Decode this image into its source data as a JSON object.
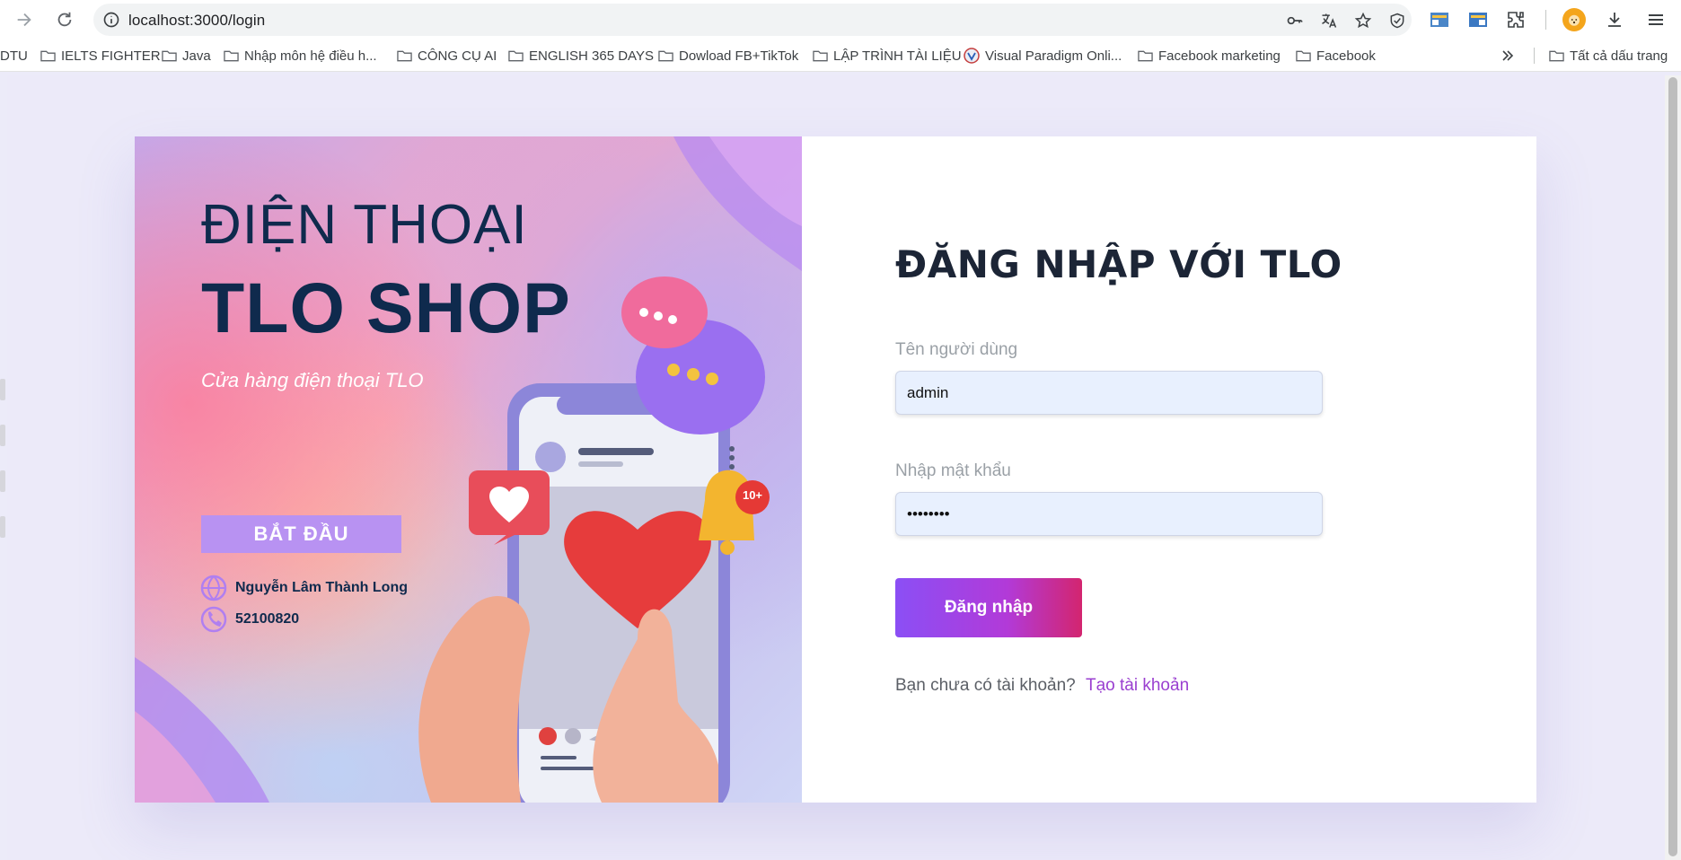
{
  "browser": {
    "url": "localhost:3000/login",
    "bookmarks": [
      {
        "label": "DTU",
        "folder": false
      },
      {
        "label": "IELTS FIGHTER",
        "folder": true
      },
      {
        "label": "Java",
        "folder": true
      },
      {
        "label": "Nhập môn hệ điều h...",
        "folder": true
      },
      {
        "label": "CÔNG CỤ AI",
        "folder": true
      },
      {
        "label": "ENGLISH 365 DAYS",
        "folder": true
      },
      {
        "label": "Dowload FB+TikTok",
        "folder": true
      },
      {
        "label": "LẬP TRÌNH TÀI LIỆU",
        "folder": true
      },
      {
        "label": "Visual Paradigm Onli...",
        "folder": false
      },
      {
        "label": "Facebook marketing",
        "folder": true
      },
      {
        "label": "Facebook",
        "folder": true
      }
    ],
    "all_bookmarks_label": "Tất cả dấu trang"
  },
  "banner": {
    "title_line1": "ĐIỆN THOẠI",
    "title_line2": "TLO SHOP",
    "tagline": "Cửa hàng điện thoại TLO",
    "start_label": "BẮT ĐẦU",
    "author": "Nguyễn Lâm Thành Long",
    "phone": "52100820",
    "notification_badge": "10+"
  },
  "form": {
    "title": "ĐĂNG NHẬP VỚI TLO",
    "username_label": "Tên người dùng",
    "username_value": "admin",
    "password_label": "Nhập mật khẩu",
    "password_value": "12345678",
    "login_label": "Đăng nhập",
    "no_account_text": "Bạn chưa có tài khoản?",
    "create_account_label": "Tạo tài khoản"
  },
  "colors": {
    "brand_navy": "#0f2a4d",
    "accent_purple": "#8b4ff5",
    "accent_pink": "#d3256f",
    "link": "#9a3fd0",
    "input_bg": "#e8f0fe"
  }
}
